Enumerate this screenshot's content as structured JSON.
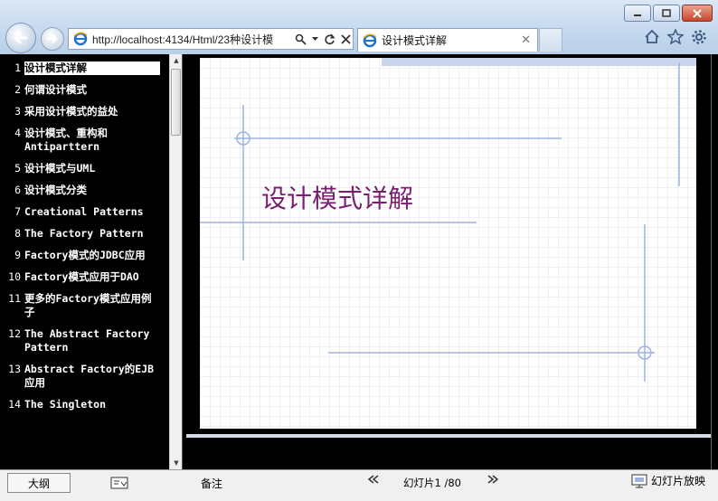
{
  "browser": {
    "address": "http://localhost:4134/Html/23种设计模",
    "tab_title": "设计模式详解"
  },
  "outline": {
    "items": [
      {
        "num": "1",
        "text": "设计模式详解",
        "selected": true
      },
      {
        "num": "2",
        "text": "何谓设计模式"
      },
      {
        "num": "3",
        "text": "采用设计模式的益处"
      },
      {
        "num": "4",
        "text": "设计模式、重构和Antiparttern"
      },
      {
        "num": "5",
        "text": "设计模式与UML"
      },
      {
        "num": "6",
        "text": "设计模式分类"
      },
      {
        "num": "7",
        "text": "Creational Patterns"
      },
      {
        "num": "8",
        "text": "The Factory Pattern"
      },
      {
        "num": "9",
        "text": "Factory模式的JDBC应用"
      },
      {
        "num": "10",
        "text": "Factory模式应用于DAO"
      },
      {
        "num": "11",
        "text": "更多的Factory模式应用例子"
      },
      {
        "num": "12",
        "text": "The Abstract Factory Pattern"
      },
      {
        "num": "13",
        "text": "Abstract Factory的EJB应用"
      },
      {
        "num": "14",
        "text": "The Singleton"
      }
    ]
  },
  "slide": {
    "title": "设计模式详解",
    "title_color": "#7a1e6f",
    "accent_color": "#9db3e0"
  },
  "bottom": {
    "outline_label": "大纲",
    "notes_label": "备注",
    "slide_counter": "幻灯片1 /80",
    "slideshow_label": "幻灯片放映"
  }
}
